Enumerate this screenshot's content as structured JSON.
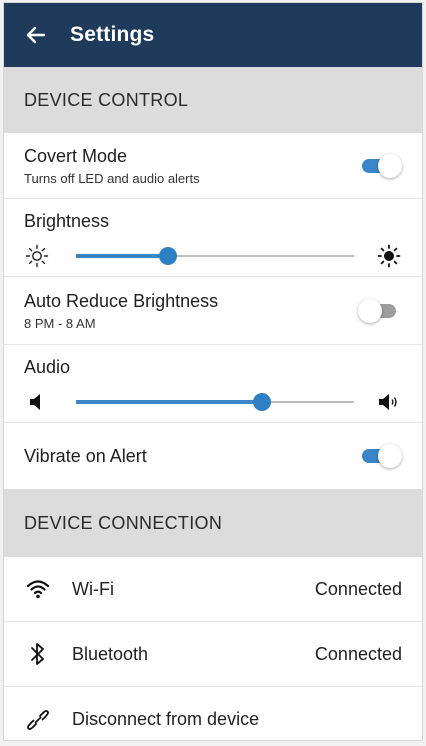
{
  "header": {
    "title": "Settings",
    "back_icon": "arrow-left-icon"
  },
  "colors": {
    "appbar": "#1f3b5c",
    "accent": "#3a86c8",
    "section_bg": "#dcdcdc"
  },
  "device_control": {
    "header": "DEVICE CONTROL",
    "covert_mode": {
      "title": "Covert Mode",
      "subtitle": "Turns off LED and audio alerts",
      "enabled": true
    },
    "brightness": {
      "title": "Brightness",
      "level": 0.33,
      "min_icon": "sun-outline-icon",
      "max_icon": "sun-filled-icon"
    },
    "auto_reduce": {
      "title": "Auto Reduce Brightness",
      "subtitle": "8 PM - 8 AM",
      "enabled": false
    },
    "audio": {
      "title": "Audio",
      "level": 0.67,
      "min_icon": "volume-low-icon",
      "max_icon": "volume-high-icon"
    },
    "vibrate": {
      "title": "Vibrate on Alert",
      "enabled": true
    }
  },
  "device_connection": {
    "header": "DEVICE CONNECTION",
    "wifi": {
      "label": "Wi-Fi",
      "status": "Connected",
      "icon": "wifi-icon"
    },
    "bluetooth": {
      "label": "Bluetooth",
      "status": "Connected",
      "icon": "bluetooth-icon"
    },
    "disconnect": {
      "label": "Disconnect from device",
      "icon": "link-broken-icon"
    }
  }
}
